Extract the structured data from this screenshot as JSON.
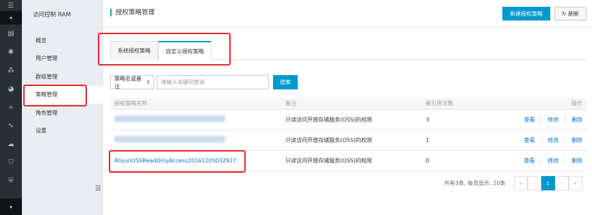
{
  "rail": {
    "icons": [
      "menu-icon",
      "server-icon",
      "cloud-icon",
      "network-icon",
      "cdn-icon",
      "database-icon",
      "route-icon",
      "storage-icon",
      "shield-icon",
      "security-icon"
    ]
  },
  "sidebar": {
    "header": "访问控制 RAM",
    "items": [
      {
        "label": "概览"
      },
      {
        "label": "用户管理"
      },
      {
        "label": "群组管理"
      },
      {
        "label": "策略管理"
      },
      {
        "label": "角色管理"
      },
      {
        "label": "设置"
      }
    ],
    "active_index": 3
  },
  "header": {
    "title": "授权策略管理",
    "new_button": "新建授权策略",
    "refresh_button": "刷新"
  },
  "tabs": [
    {
      "label": "系统授权策略"
    },
    {
      "label": "自定义授权策略"
    }
  ],
  "filter": {
    "select_value": "策略名或备注",
    "input_placeholder": "请输入关键词查询",
    "search_button": "搜索"
  },
  "table": {
    "columns": [
      "授权策略名称",
      "备注",
      "被引用次数",
      "操作"
    ],
    "rows": [
      {
        "name": "",
        "remark": "只读访问开放存储服务(OSS)的权限",
        "count": "3"
      },
      {
        "name": "",
        "remark": "只读访问开放存储服务(OSS)的权限",
        "count": "1"
      },
      {
        "name": "AliyunOSSReadOnlyAccess20161205032927",
        "remark": "只读访问开放存储服务(OSS)的权限",
        "count": "0"
      }
    ],
    "actions": {
      "view": "查看",
      "edit": "修改",
      "delete": "删除",
      "sep": "|"
    }
  },
  "pagination": {
    "info": "共有3条, 每页显示: 20条",
    "first": "«",
    "prev": "‹",
    "current": "1",
    "next": "›",
    "last": "»"
  },
  "colors": {
    "primary": "#0099cc",
    "link": "#0073cc",
    "highlight": "#e3242b",
    "rail": "#2a2f36",
    "sidebar": "#eaedf1"
  }
}
